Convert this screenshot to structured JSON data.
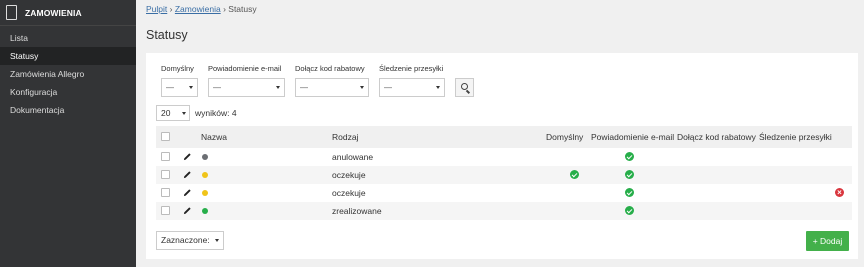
{
  "sidebar": {
    "title": "ZAMOWIENIA",
    "items": [
      {
        "label": "Lista"
      },
      {
        "label": "Statusy"
      },
      {
        "label": "Zamówienia Allegro"
      },
      {
        "label": "Konfiguracja"
      },
      {
        "label": "Dokumentacja"
      }
    ],
    "active_index": 1
  },
  "breadcrumb": {
    "home": "Pulpit",
    "section": "Zamowienia",
    "current": "Statusy",
    "separator": "›"
  },
  "page_title": "Statusy",
  "filters": [
    {
      "label": "Domyślny",
      "value": "—"
    },
    {
      "label": "Powiadomienie e-mail",
      "value": "—"
    },
    {
      "label": "Dołącz kod rabatowy",
      "value": "—"
    },
    {
      "label": "Śledzenie przesyłki",
      "value": "—"
    }
  ],
  "pagination": {
    "per_page": "20",
    "results_text": "wyników: 4"
  },
  "table": {
    "headers": {
      "name": "Nazwa",
      "type": "Rodzaj",
      "default": "Domyślny",
      "email": "Powiadomienie e-mail",
      "discount": "Dołącz kod rabatowy",
      "tracking": "Śledzenie przesyłki"
    },
    "rows": [
      {
        "name": "anulowane",
        "color": "#6b6e73",
        "default": false,
        "email": true,
        "discount": false,
        "tracking": false,
        "delete": false
      },
      {
        "name": "oczekuje",
        "color": "#f0c419",
        "default": true,
        "email": true,
        "discount": false,
        "tracking": false,
        "delete": false
      },
      {
        "name": "oczekuje",
        "color": "#f0c419",
        "default": false,
        "email": true,
        "discount": false,
        "tracking": false,
        "delete": true
      },
      {
        "name": "zrealizowane",
        "color": "#27ae4a",
        "default": false,
        "email": true,
        "discount": false,
        "tracking": false,
        "delete": false
      }
    ]
  },
  "footer": {
    "bulk_label": "Zaznaczone:",
    "add_label": "+ Dodaj"
  },
  "colors": {
    "sidebar_bg": "#333436",
    "accent_green": "#43b04a",
    "check_green": "#27ae4a",
    "delete_red": "#d9363e",
    "link_blue": "#3a6ea5"
  },
  "icons": [
    "document-icon",
    "search-icon",
    "pencil-icon",
    "check-circle-icon",
    "close-circle-icon",
    "caret-down-icon"
  ]
}
